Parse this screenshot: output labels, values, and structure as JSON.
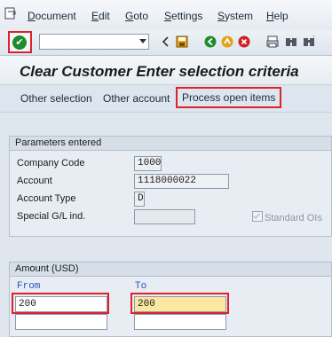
{
  "menu": {
    "items": [
      {
        "label": "Document",
        "underline": "D",
        "rest": "ocument"
      },
      {
        "label": "Edit",
        "underline": "E",
        "rest": "dit"
      },
      {
        "label": "Goto",
        "underline": "G",
        "rest": "oto"
      },
      {
        "label": "Settings",
        "underline": "S",
        "rest": "ettings"
      },
      {
        "label": "System",
        "underline": "S",
        "rest": "ystem"
      },
      {
        "label": "Help",
        "underline": "H",
        "rest": "elp"
      }
    ]
  },
  "toolbar": {
    "command_value": "",
    "icons": [
      "enter-icon",
      "back-nav-icon",
      "save-icon",
      "back-icon",
      "exit-icon",
      "cancel-icon",
      "print-icon",
      "find-icon",
      "find-next-icon"
    ]
  },
  "title": "Clear Customer Enter selection criteria",
  "app_toolbar": {
    "other_selection": "Other selection",
    "other_account": "Other account",
    "process_open_items": "Process open items"
  },
  "parameters": {
    "heading": "Parameters entered",
    "company_code_label": "Company Code",
    "company_code_value": "1000",
    "account_label": "Account",
    "account_value": "1118000022",
    "account_type_label": "Account Type",
    "account_type_value": "D",
    "special_gl_label": "Special G/L ind.",
    "special_gl_value": "",
    "standard_ois_label": "Standard OIs",
    "standard_ois_checked": true
  },
  "amount": {
    "heading": "Amount (USD)",
    "from_label": "From",
    "to_label": "To",
    "from_value": "200",
    "to_value": "200"
  },
  "colors": {
    "highlight": "#e0202a",
    "accent_blue": "#2f4fc4",
    "to_field_bg": "#fbe7a0"
  }
}
